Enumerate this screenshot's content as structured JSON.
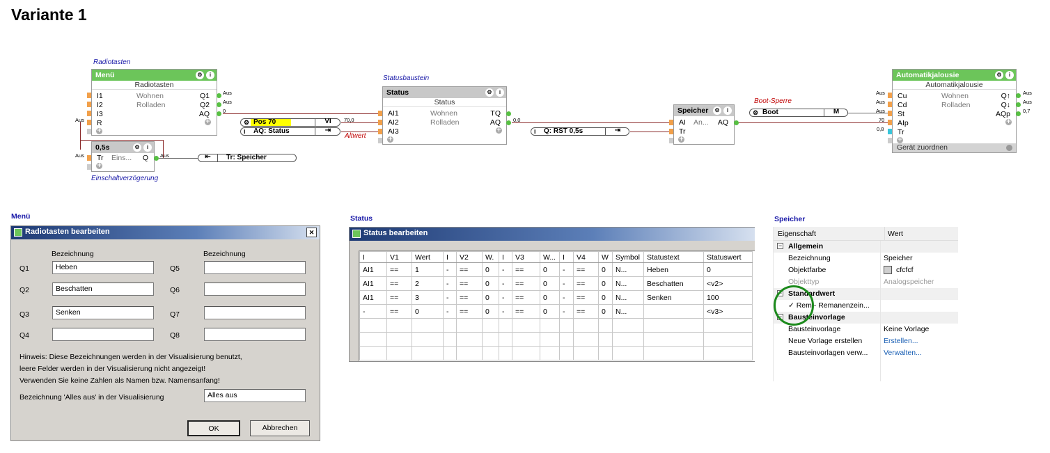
{
  "page_title": "Variante 1",
  "colors": {
    "block_header_green": "#6cc55a",
    "block_header_gray": "#c8c8c8",
    "input_pin": "#f2a04a",
    "output_pin": "#57c043",
    "wire": "#8b2a2a",
    "highlight": "#ffff00",
    "caption_blue": "#1a1aa8",
    "caption_red": "#c00000",
    "circle": "#1c8a1c"
  },
  "captions": {
    "radiotasten": "Radiotasten",
    "statusbaustein": "Statusbaustein",
    "einschaltverzoegerung": "Einschaltverzögerung",
    "altwert": "Altwert",
    "boot_sperre": "Boot-Sperre"
  },
  "menu_block": {
    "title": "Menü",
    "subtitle": "Radiotasten",
    "inputs": [
      "I1",
      "I2",
      "I3",
      "R"
    ],
    "outputs": [
      "Q1",
      "Q2",
      "AQ"
    ],
    "mid": [
      "Wohnen",
      "Rolladen"
    ],
    "out_vals": [
      "Aus",
      "Aus",
      "0"
    ],
    "in_val_r": "Aus"
  },
  "delay_block": {
    "title": "0,5s",
    "input": "Tr",
    "mid": "Eins...",
    "output": "Q",
    "in_val": "Aus",
    "out_val": "Aus"
  },
  "connectors": {
    "pos70": "Pos 70",
    "pos70_tag": "VI",
    "aq_status": "AQ: Status",
    "tr_speicher": "Tr: Speicher",
    "q_rst": "Q: RST 0,5s",
    "boot": "Boot",
    "boot_tag": "M"
  },
  "status_block": {
    "title": "Status",
    "subtitle": "Status",
    "inputs": [
      "AI1",
      "AI2",
      "AI3"
    ],
    "outputs": [
      "TQ",
      "AQ"
    ],
    "mid": [
      "Wohnen",
      "Rolladen"
    ],
    "in_val": "70,0",
    "out_val": "0,0"
  },
  "speicher_block": {
    "title": "Speicher",
    "inputs": [
      "AI",
      "Tr"
    ],
    "mid": "An...",
    "output": "AQ"
  },
  "jalousie_block": {
    "title": "Automatikjalousie",
    "subtitle": "Automatikjalousie",
    "inputs": [
      "Cu",
      "Cd",
      "St",
      "AIp",
      "Tr"
    ],
    "outputs": [
      "Q↑",
      "Q↓",
      "AQp"
    ],
    "mid": [
      "Wohnen",
      "Rolladen"
    ],
    "in_vals": [
      "Aus",
      "Aus",
      "Aus",
      "70",
      "0,8"
    ],
    "out_vals": [
      "Aus",
      "Aus",
      "0,7"
    ],
    "footer": "Gerät zuordnen"
  },
  "section_labels": {
    "menu": "Menü",
    "status": "Status",
    "speicher": "Speicher"
  },
  "radio_dialog": {
    "title": "Radiotasten bearbeiten",
    "col_header": "Bezeichnung",
    "left": [
      {
        "q": "Q1",
        "val": "Heben"
      },
      {
        "q": "Q2",
        "val": "Beschatten"
      },
      {
        "q": "Q3",
        "val": "Senken"
      },
      {
        "q": "Q4",
        "val": ""
      }
    ],
    "right": [
      {
        "q": "Q5",
        "val": ""
      },
      {
        "q": "Q6",
        "val": ""
      },
      {
        "q": "Q7",
        "val": ""
      },
      {
        "q": "Q8",
        "val": ""
      }
    ],
    "hint_lines": [
      "Hinweis: Diese Bezeichnungen werden in der Visualisierung benutzt,",
      "leere Felder werden in der Visualisierung nicht angezeigt!",
      "Verwenden Sie keine Zahlen als Namen bzw. Namensanfang!"
    ],
    "alles_aus_label": "Bezeichnung 'Alles aus' in der Visualisierung",
    "alles_aus_value": "Alles aus",
    "ok": "OK",
    "cancel": "Abbrechen",
    "close": "✕"
  },
  "status_dialog": {
    "title": "Status bearbeiten",
    "headers": [
      "I",
      "V1",
      "Wert",
      "I",
      "V2",
      "W.",
      "I",
      "V3",
      "W...",
      "I",
      "V4",
      "W",
      "Symbol",
      "Statustext",
      "Statuswert"
    ],
    "rows": [
      [
        "AI1",
        "==",
        "1",
        "-",
        "==",
        "0",
        "-",
        "==",
        "0",
        "-",
        "==",
        "0",
        "N...",
        "Heben",
        "0"
      ],
      [
        "AI1",
        "==",
        "2",
        "-",
        "==",
        "0",
        "-",
        "==",
        "0",
        "-",
        "==",
        "0",
        "N...",
        "Beschatten",
        "<v2>"
      ],
      [
        "AI1",
        "==",
        "3",
        "-",
        "==",
        "0",
        "-",
        "==",
        "0",
        "-",
        "==",
        "0",
        "N...",
        "Senken",
        "100"
      ],
      [
        "-",
        "==",
        "0",
        "-",
        "==",
        "0",
        "-",
        "==",
        "0",
        "-",
        "==",
        "0",
        "N...",
        "",
        "<v3>"
      ]
    ]
  },
  "properties": {
    "col_prop": "Eigenschaft",
    "col_val": "Wert",
    "groups": [
      {
        "name": "Allgemein",
        "rows": [
          [
            "Bezeichnung",
            "Speicher"
          ],
          [
            "Objektfarbe",
            "cfcfcf"
          ],
          [
            "Objekttyp",
            "Analogspeicher"
          ]
        ]
      },
      {
        "name": "Standardwert",
        "rows": [
          [
            "✓  Rem - Remanenzein...",
            ""
          ]
        ]
      },
      {
        "name": "Bausteinvorlage",
        "rows": [
          [
            "Bausteinvorlage",
            "Keine Vorlage"
          ],
          [
            "Neue Vorlage erstellen",
            "Erstellen..."
          ],
          [
            "Bausteinvorlagen verw...",
            "Verwalten..."
          ]
        ]
      }
    ]
  }
}
